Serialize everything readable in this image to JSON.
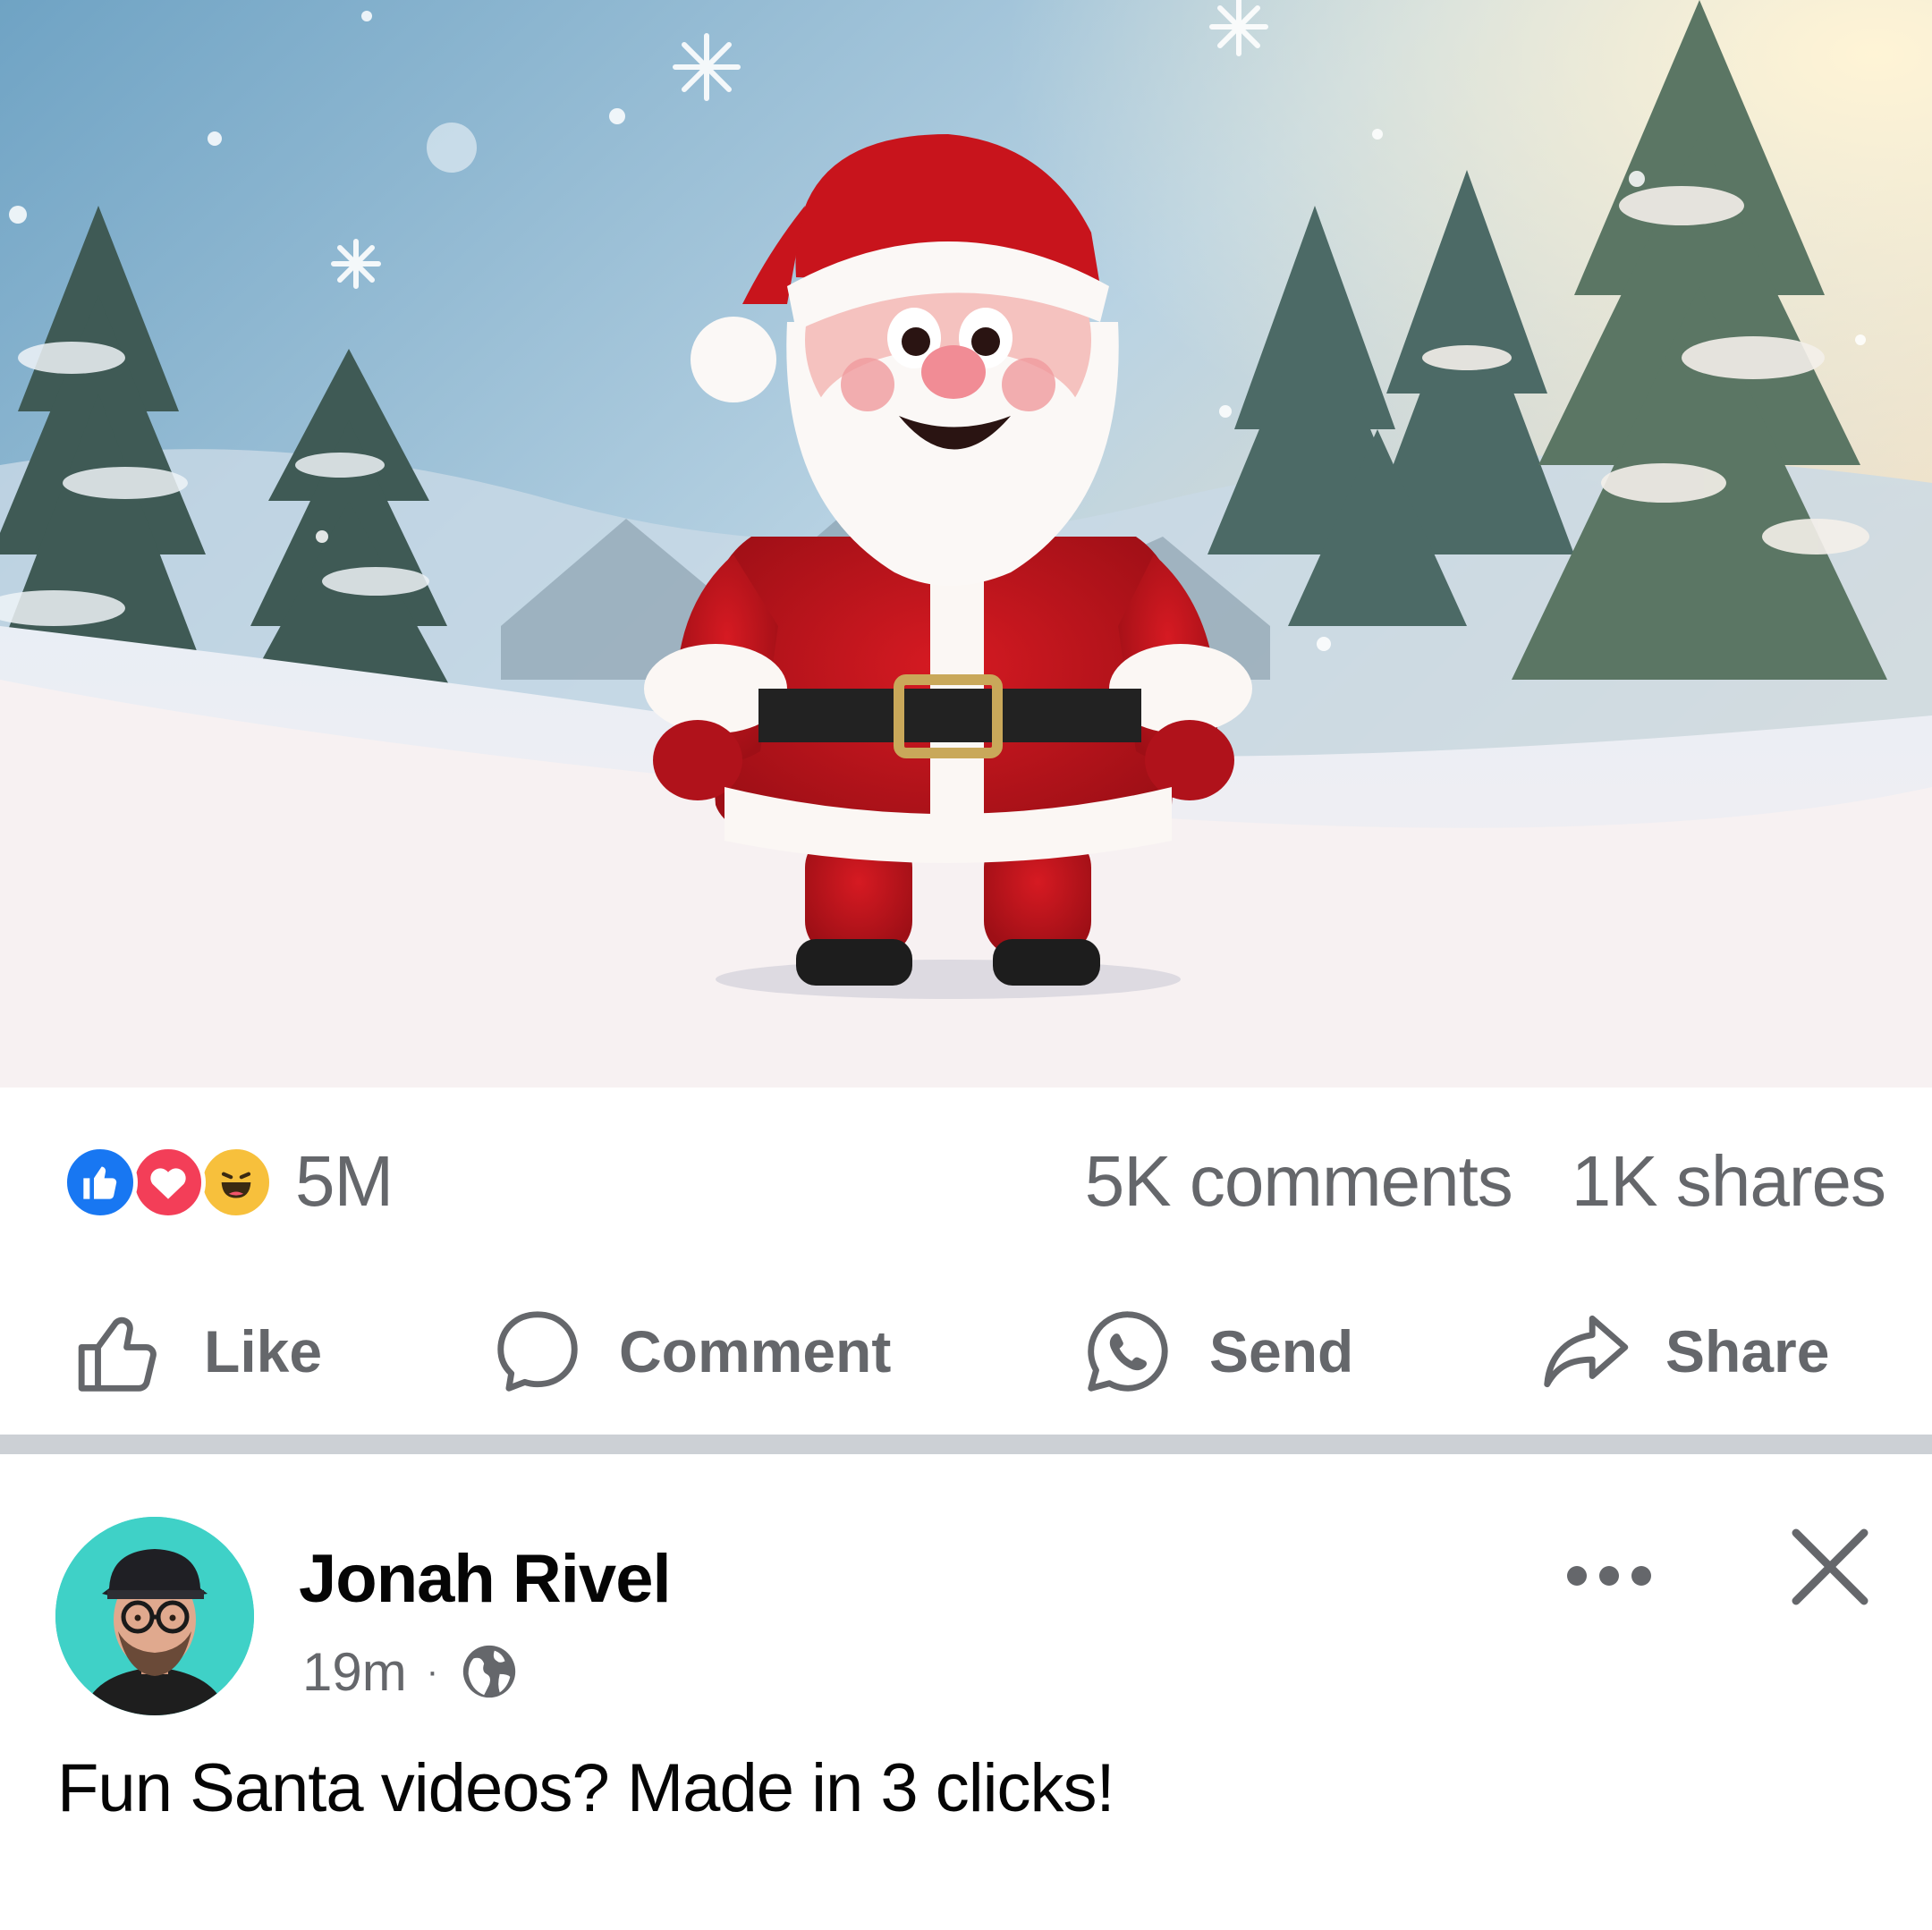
{
  "post": {
    "author": "Jonah Rivel",
    "time": "19m",
    "separator": "·",
    "privacy_icon": "globe-icon",
    "text": "Fun Santa videos? Made in 3 clicks!",
    "menu_icon": "more-options-icon",
    "close_icon": "close-icon"
  },
  "stats": {
    "reactions_count": "5M",
    "reaction_types": [
      "like-icon",
      "love-icon",
      "haha-icon"
    ],
    "comments": "5K comments",
    "shares": "1K shares"
  },
  "actions": {
    "like": "Like",
    "comment": "Comment",
    "send": "Send",
    "share": "Share"
  },
  "colors": {
    "like_blue": "#1877f2",
    "love_red": "#f33e58",
    "haha_yellow": "#f7c03c",
    "muted_text": "#65676b",
    "avatar_bg": "#3fd1c7"
  }
}
